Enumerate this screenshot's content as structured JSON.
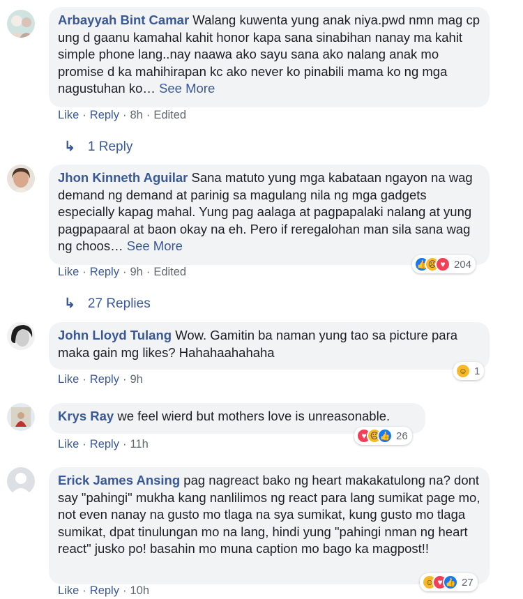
{
  "comments": [
    {
      "author": "Arbayyah Bint Camar",
      "text": "Walang kuwenta yung anak niya.pwd nmn mag cp ung d gaanu kamahal kahit honor kapa sana sinabihan nanay ma kahit simple phone lang..nay naawa ako sayu sana ako nalang anak mo promise d ka mahihirapan kc ako never ko pinabili mama ko ng mga nagustuhan ko…",
      "see_more": "See More",
      "like": "Like",
      "reply": "Reply",
      "time": "8h",
      "edited": "Edited",
      "replies": "1 Reply"
    },
    {
      "author": "Jhon Kinneth Aguilar",
      "text": "Sana matuto yung mga kabataan ngayon na wag demand ng demand at parinig sa magulang nila ng mga gadgets especially kapag mahal. Yung pag aalaga at pagpapalaki nalang at yung pagpapaaral at baon okay na eh. Pero if reregalohan man sila sana wag ng choos…",
      "see_more": "See More",
      "like": "Like",
      "reply": "Reply",
      "time": "9h",
      "edited": "Edited",
      "reaction_count": "204",
      "reactions": [
        "like-icon",
        "sad-icon",
        "love-icon"
      ],
      "replies": "27 Replies"
    },
    {
      "author": "John Lloyd Tulang",
      "text": "Wow. Gamitin ba naman yung tao sa picture para maka gain mg likes? Hahahaahahaha",
      "like": "Like",
      "reply": "Reply",
      "time": "9h",
      "reaction_count": "1",
      "reactions": [
        "haha-icon"
      ]
    },
    {
      "author": "Krys Ray",
      "text": "we feel wierd but mothers love is unreasonable.",
      "like": "Like",
      "reply": "Reply",
      "time": "11h",
      "reaction_count": "26",
      "reactions": [
        "love-icon",
        "sad-icon",
        "like-icon"
      ]
    },
    {
      "author": "Erick James Ansing",
      "text": "pag nagreact bako ng heart makakatulong na? dont say \"pahingi\" mukha kang nanlilimos ng react para lang sumikat page mo, not even nanay na gusto mo tlaga na sya sumikat, kung gusto mo tlaga sumikat, dpat tinulungan mo na lang, hindi yung \"pahingi nman ng heart react\" jusko po! basahin mo muna caption mo bago ka magpost!!",
      "like": "Like",
      "reply": "Reply",
      "time": "10h",
      "reaction_count": "27",
      "reactions": [
        "haha-icon",
        "love-icon",
        "like-icon"
      ]
    }
  ],
  "colors": {
    "link": "#385898",
    "bubble": "#f2f3f5",
    "meta": "#606770",
    "like": "#1877f2",
    "love": "#f33e58",
    "sad": "#f7b928"
  }
}
